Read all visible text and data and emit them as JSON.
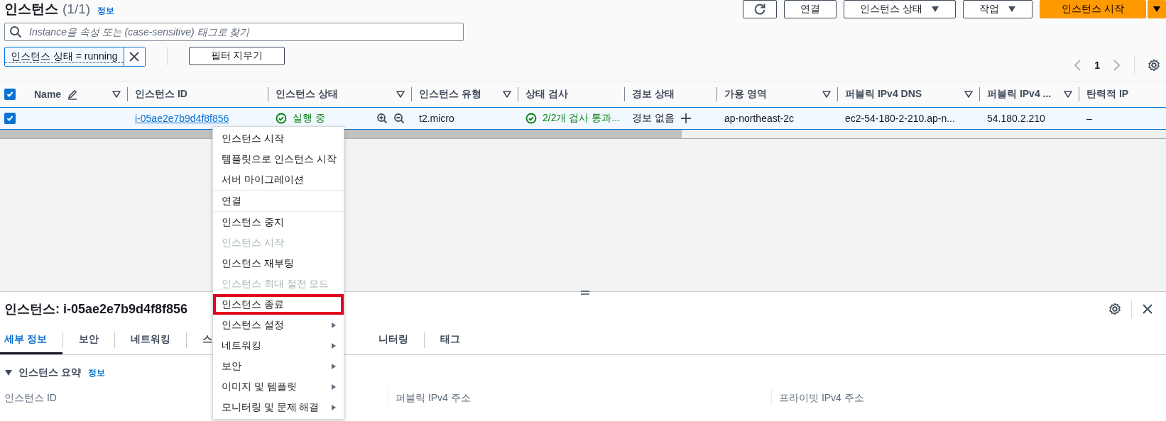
{
  "header": {
    "title": "인스턴스",
    "count": "(1/1)",
    "info_link": "정보"
  },
  "toolbar": [
    {
      "kind": "refresh"
    },
    {
      "kind": "plain",
      "label": "연결"
    },
    {
      "kind": "dropdown",
      "label": "인스턴스 상태"
    },
    {
      "kind": "dropdown",
      "label": "작업"
    },
    {
      "kind": "primary-split",
      "label": "인스턴스 시작"
    }
  ],
  "search": {
    "placeholder": "Instance을 속성 또는 (case-sensitive) 태그로 찾기"
  },
  "filters": [
    {
      "label": "인스턴스 상태 = running"
    }
  ],
  "clear_filters": "필터 지우기",
  "pagination": {
    "page": "1",
    "previous_disabled": true,
    "next_disabled": true
  },
  "table": {
    "select_all_checked": true,
    "columns": [
      {
        "label": "Name",
        "editable": true,
        "filter": true
      },
      {
        "label": "인스턴스 ID",
        "editable": false,
        "filter": false
      },
      {
        "label": "인스턴스 상태",
        "editable": false,
        "filter": true
      },
      {
        "label": "인스턴스 유형",
        "editable": false,
        "filter": true
      },
      {
        "label": "상태 검사",
        "editable": false,
        "filter": false
      },
      {
        "label": "경보 상태",
        "editable": false,
        "filter": false
      },
      {
        "label": "가용 영역",
        "editable": false,
        "filter": true
      },
      {
        "label": "퍼블릭 IPv4 DNS",
        "editable": false,
        "filter": true
      },
      {
        "label": "퍼블릭 IPv4 ...",
        "editable": false,
        "filter": true
      },
      {
        "label": "탄력적 IP",
        "editable": false,
        "filter": false
      }
    ],
    "rows": [
      {
        "selected": true,
        "cells": [
          {
            "kind": "empty"
          },
          {
            "kind": "link",
            "text": "i-05ae2e7b9d4f8f856"
          },
          {
            "kind": "status",
            "text": "실행 중"
          },
          {
            "kind": "text",
            "text": "t2.micro"
          },
          {
            "kind": "check",
            "text": "2/2개 검사 통과..."
          },
          {
            "kind": "alarm",
            "text": "경보 없음"
          },
          {
            "kind": "text",
            "text": "ap-northeast-2c"
          },
          {
            "kind": "text",
            "text": "ec2-54-180-2-210.ap-n..."
          },
          {
            "kind": "text",
            "text": "54.180.2.210"
          },
          {
            "kind": "text",
            "text": "–"
          }
        ]
      }
    ]
  },
  "context_menu": {
    "groups": [
      [
        {
          "label": "인스턴스 시작",
          "disabled": false,
          "submenu": false,
          "highlighted": false
        },
        {
          "label": "템플릿으로 인스턴스 시작",
          "disabled": false,
          "submenu": false,
          "highlighted": false
        },
        {
          "label": "서버 마이그레이션",
          "disabled": false,
          "submenu": false,
          "highlighted": false
        }
      ],
      [
        {
          "label": "연결",
          "disabled": false,
          "submenu": false,
          "highlighted": false
        }
      ],
      [
        {
          "label": "인스턴스 중지",
          "disabled": false,
          "submenu": false,
          "highlighted": false
        },
        {
          "label": "인스턴스 시작",
          "disabled": true,
          "submenu": false,
          "highlighted": false
        },
        {
          "label": "인스턴스 재부팅",
          "disabled": false,
          "submenu": false,
          "highlighted": false
        },
        {
          "label": "인스턴스 최대 절전 모드",
          "disabled": true,
          "submenu": false,
          "highlighted": false
        },
        {
          "label": "인스턴스 종료",
          "disabled": false,
          "submenu": false,
          "highlighted": true
        },
        {
          "label": "인스턴스 설정",
          "disabled": false,
          "submenu": true,
          "highlighted": false
        },
        {
          "label": "네트워킹",
          "disabled": false,
          "submenu": true,
          "highlighted": false
        },
        {
          "label": "보안",
          "disabled": false,
          "submenu": true,
          "highlighted": false
        },
        {
          "label": "이미지 및 템플릿",
          "disabled": false,
          "submenu": true,
          "highlighted": false
        },
        {
          "label": "모니터링 및 문제 해결",
          "disabled": false,
          "submenu": true,
          "highlighted": false
        }
      ]
    ]
  },
  "details": {
    "title": "인스턴스: i-05ae2e7b9d4f8f856",
    "tabs": [
      {
        "label": "세부 정보",
        "selected": true
      },
      {
        "label": "보안",
        "selected": false
      },
      {
        "label": "네트워킹",
        "selected": false
      },
      {
        "label": "스",
        "selected": false
      },
      {
        "label": "니터링",
        "selected": false
      },
      {
        "label": "태그",
        "selected": false
      }
    ],
    "section": {
      "title": "인스턴스 요약",
      "info_link": "정보",
      "expanded": true
    },
    "fields": [
      {
        "label": "인스턴스 ID"
      },
      {
        "label": "퍼블릭 IPv4 주소"
      },
      {
        "label": "프라이빗 IPv4 주소"
      }
    ]
  }
}
